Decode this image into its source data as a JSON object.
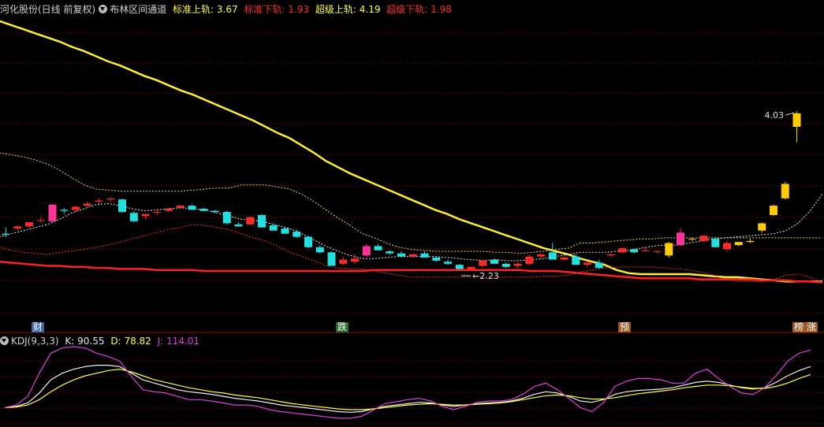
{
  "header": {
    "stock_title": "河化股份(日线 前复权)",
    "indicator_name": "布林区间通道",
    "std_upper": {
      "label": "标准上轨:",
      "value": "3.67"
    },
    "std_lower": {
      "label": "标准下轨:",
      "value": "1.93"
    },
    "super_upper": {
      "label": "超级上轨:",
      "value": "4.19"
    },
    "super_lower": {
      "label": "超级下轨:",
      "value": "1.98"
    }
  },
  "kdj_header": {
    "name": "KDJ(9,3,3)",
    "k": {
      "label": "K:",
      "value": "90.55"
    },
    "d": {
      "label": "D:",
      "value": "78.82"
    },
    "j": {
      "label": "J:",
      "value": "114.01"
    }
  },
  "tags": {
    "cai": "财",
    "die": "跌",
    "yu": "预",
    "bang": "榜",
    "zhang": "涨"
  },
  "annotations": {
    "high_label": "4.03",
    "low_label": "2.23"
  },
  "colors": {
    "up": "#ff2b2b",
    "down": "#23e0e0",
    "yellow": "#ffff33",
    "magenta": "#e040e0",
    "super_upper": "#ffee33",
    "super_lower": "#ff2020",
    "grid": "#7a0000"
  },
  "chart_data": [
    {
      "type": "candlestick",
      "title": "布林区间通道",
      "ylim": [
        1.75,
        4.65
      ],
      "candles": [
        [
          2.55,
          2.61,
          2.52,
          2.54
        ],
        [
          2.6,
          2.63,
          2.58,
          2.62
        ],
        [
          2.62,
          2.66,
          2.6,
          2.66
        ],
        [
          2.68,
          2.71,
          2.66,
          2.68
        ],
        [
          2.67,
          2.84,
          2.66,
          2.83
        ],
        [
          2.78,
          2.8,
          2.74,
          2.77
        ],
        [
          2.78,
          2.82,
          2.76,
          2.81
        ],
        [
          2.82,
          2.86,
          2.81,
          2.84
        ],
        [
          2.86,
          2.89,
          2.84,
          2.87
        ],
        [
          2.88,
          2.9,
          2.86,
          2.89
        ],
        [
          2.88,
          2.89,
          2.75,
          2.76
        ],
        [
          2.75,
          2.77,
          2.66,
          2.67
        ],
        [
          2.72,
          2.74,
          2.69,
          2.74
        ],
        [
          2.76,
          2.78,
          2.73,
          2.76
        ],
        [
          2.77,
          2.8,
          2.76,
          2.79
        ],
        [
          2.8,
          2.83,
          2.79,
          2.82
        ],
        [
          2.82,
          2.83,
          2.78,
          2.78
        ],
        [
          2.79,
          2.8,
          2.76,
          2.77
        ],
        [
          2.77,
          2.78,
          2.75,
          2.76
        ],
        [
          2.76,
          2.77,
          2.64,
          2.65
        ],
        [
          2.64,
          2.66,
          2.62,
          2.62
        ],
        [
          2.64,
          2.72,
          2.63,
          2.71
        ],
        [
          2.73,
          2.74,
          2.61,
          2.61
        ],
        [
          2.63,
          2.64,
          2.58,
          2.58
        ],
        [
          2.6,
          2.61,
          2.55,
          2.55
        ],
        [
          2.57,
          2.59,
          2.51,
          2.52
        ],
        [
          2.52,
          2.53,
          2.41,
          2.42
        ],
        [
          2.42,
          2.44,
          2.36,
          2.37
        ],
        [
          2.37,
          2.38,
          2.24,
          2.24
        ],
        [
          2.26,
          2.33,
          2.25,
          2.3
        ],
        [
          2.28,
          2.35,
          2.26,
          2.31
        ],
        [
          2.34,
          2.45,
          2.33,
          2.43
        ],
        [
          2.43,
          2.45,
          2.39,
          2.39
        ],
        [
          2.38,
          2.39,
          2.35,
          2.36
        ],
        [
          2.36,
          2.38,
          2.32,
          2.33
        ],
        [
          2.33,
          2.36,
          2.32,
          2.35
        ],
        [
          2.36,
          2.38,
          2.32,
          2.32
        ],
        [
          2.32,
          2.33,
          2.28,
          2.29
        ],
        [
          2.28,
          2.3,
          2.25,
          2.26
        ],
        [
          2.25,
          2.26,
          2.21,
          2.21
        ],
        [
          2.21,
          2.23,
          2.19,
          2.23
        ],
        [
          2.24,
          2.3,
          2.23,
          2.29
        ],
        [
          2.3,
          2.31,
          2.26,
          2.26
        ],
        [
          2.26,
          2.27,
          2.22,
          2.23
        ],
        [
          2.24,
          2.27,
          2.22,
          2.26
        ],
        [
          2.26,
          2.35,
          2.25,
          2.33
        ],
        [
          2.33,
          2.36,
          2.31,
          2.35
        ],
        [
          2.37,
          2.46,
          2.3,
          2.3
        ],
        [
          2.3,
          2.33,
          2.29,
          2.32
        ],
        [
          2.33,
          2.35,
          2.25,
          2.25
        ],
        [
          2.25,
          2.28,
          2.23,
          2.27
        ],
        [
          2.27,
          2.3,
          2.21,
          2.22
        ],
        [
          2.34,
          2.36,
          2.33,
          2.35
        ],
        [
          2.37,
          2.42,
          2.36,
          2.41
        ],
        [
          2.4,
          2.41,
          2.36,
          2.37
        ],
        [
          2.39,
          2.42,
          2.38,
          2.39
        ],
        [
          2.38,
          2.39,
          2.36,
          2.38
        ],
        [
          2.34,
          2.47,
          2.32,
          2.46
        ],
        [
          2.44,
          2.6,
          2.43,
          2.56
        ],
        [
          2.5,
          2.51,
          2.48,
          2.5
        ],
        [
          2.48,
          2.54,
          2.47,
          2.53
        ],
        [
          2.5,
          2.51,
          2.42,
          2.42
        ],
        [
          2.4,
          2.48,
          2.38,
          2.46
        ],
        [
          2.44,
          2.47,
          2.43,
          2.47
        ],
        [
          2.47,
          2.5,
          2.46,
          2.48
        ],
        [
          2.58,
          2.66,
          2.56,
          2.65
        ],
        [
          2.73,
          2.83,
          2.72,
          2.82
        ],
        [
          2.89,
          3.05,
          2.88,
          3.03
        ],
        [
          3.58,
          3.73,
          3.43,
          3.71
        ]
      ],
      "super_upper": [
        4.6,
        4.56,
        4.52,
        4.48,
        4.44,
        4.4,
        4.35,
        4.31,
        4.26,
        4.21,
        4.17,
        4.12,
        4.07,
        4.03,
        3.98,
        3.93,
        3.89,
        3.84,
        3.79,
        3.74,
        3.69,
        3.64,
        3.58,
        3.52,
        3.47,
        3.4,
        3.33,
        3.25,
        3.19,
        3.13,
        3.08,
        3.03,
        2.98,
        2.93,
        2.88,
        2.83,
        2.78,
        2.74,
        2.69,
        2.65,
        2.61,
        2.57,
        2.53,
        2.49,
        2.45,
        2.41,
        2.38,
        2.35,
        2.31,
        2.28,
        2.25,
        2.2,
        2.17,
        2.16,
        2.16,
        2.16,
        2.16,
        2.16,
        2.15,
        2.14,
        2.13,
        2.13,
        2.12,
        2.11,
        2.1,
        2.09,
        2.09,
        2.09,
        2.09
      ],
      "std_upper": [
        3.33,
        3.31,
        3.29,
        3.26,
        3.22,
        3.16,
        3.09,
        3.02,
        2.98,
        2.97,
        2.96,
        2.96,
        2.96,
        2.96,
        2.96,
        2.96,
        2.97,
        2.98,
        2.99,
        2.99,
        3.02,
        3.02,
        3.02,
        3.0,
        2.98,
        2.93,
        2.86,
        2.78,
        2.7,
        2.63,
        2.55,
        2.51,
        2.46,
        2.42,
        2.4,
        2.39,
        2.38,
        2.38,
        2.38,
        2.38,
        2.38,
        2.37,
        2.37,
        2.36,
        2.37,
        2.38,
        2.4,
        2.41,
        2.46,
        2.46,
        2.47,
        2.48,
        2.49,
        2.5,
        2.5,
        2.51,
        2.51,
        2.51,
        2.51,
        2.51,
        2.51,
        2.51,
        2.51,
        2.51,
        2.51,
        2.51,
        2.51,
        2.51,
        2.51
      ],
      "mid_line": [
        2.52,
        2.55,
        2.58,
        2.61,
        2.64,
        2.69,
        2.75,
        2.79,
        2.83,
        2.84,
        2.82,
        2.79,
        2.77,
        2.78,
        2.79,
        2.8,
        2.79,
        2.78,
        2.75,
        2.72,
        2.69,
        2.68,
        2.66,
        2.63,
        2.6,
        2.55,
        2.49,
        2.43,
        2.38,
        2.34,
        2.31,
        2.31,
        2.32,
        2.33,
        2.33,
        2.33,
        2.33,
        2.32,
        2.31,
        2.3,
        2.29,
        2.3,
        2.29,
        2.29,
        2.3,
        2.31,
        2.33,
        2.35,
        2.37,
        2.37,
        2.37,
        2.38,
        2.39,
        2.41,
        2.43,
        2.44,
        2.44,
        2.46,
        2.48,
        2.5,
        2.51,
        2.52,
        2.53,
        2.54,
        2.55,
        2.58,
        2.65,
        2.77,
        2.93
      ],
      "std_lower": [
        2.42,
        2.39,
        2.37,
        2.36,
        2.35,
        2.37,
        2.38,
        2.4,
        2.42,
        2.44,
        2.47,
        2.5,
        2.53,
        2.56,
        2.59,
        2.61,
        2.64,
        2.63,
        2.61,
        2.59,
        2.55,
        2.51,
        2.48,
        2.43,
        2.37,
        2.33,
        2.29,
        2.24,
        2.22,
        2.21,
        2.21,
        2.19,
        2.17,
        2.15,
        2.13,
        2.13,
        2.13,
        2.13,
        2.13,
        2.13,
        2.13,
        2.13,
        2.13,
        2.13,
        2.13,
        2.14,
        2.14,
        2.15,
        2.18,
        2.2,
        2.22,
        2.23,
        2.23,
        2.23,
        2.23,
        2.22,
        2.21,
        2.2,
        2.18,
        2.15,
        2.11,
        2.09,
        2.09,
        2.09,
        2.11,
        2.15,
        2.16,
        2.13,
        2.08
      ],
      "super_lower": [
        2.28,
        2.27,
        2.26,
        2.25,
        2.24,
        2.24,
        2.23,
        2.23,
        2.22,
        2.22,
        2.21,
        2.21,
        2.21,
        2.2,
        2.2,
        2.2,
        2.2,
        2.19,
        2.19,
        2.19,
        2.19,
        2.19,
        2.19,
        2.19,
        2.19,
        2.19,
        2.19,
        2.19,
        2.19,
        2.19,
        2.19,
        2.2,
        2.2,
        2.2,
        2.2,
        2.2,
        2.2,
        2.2,
        2.2,
        2.2,
        2.2,
        2.2,
        2.2,
        2.2,
        2.19,
        2.19,
        2.19,
        2.18,
        2.17,
        2.16,
        2.15,
        2.14,
        2.13,
        2.12,
        2.12,
        2.12,
        2.12,
        2.12,
        2.11,
        2.11,
        2.11,
        2.11,
        2.11,
        2.1,
        2.1,
        2.1,
        2.09,
        2.09,
        2.08
      ]
    },
    {
      "type": "line",
      "title": "KDJ(9,3,3)",
      "ylim": [
        -10,
        110
      ],
      "series": [
        {
          "name": "K",
          "values": [
            18,
            20,
            25,
            40,
            60,
            70,
            76,
            80,
            82,
            82,
            80,
            70,
            60,
            55,
            50,
            45,
            42,
            40,
            38,
            35,
            32,
            30,
            28,
            25,
            22,
            20,
            18,
            16,
            14,
            12,
            11,
            12,
            16,
            20,
            22,
            24,
            26,
            25,
            22,
            20,
            22,
            24,
            25,
            26,
            28,
            32,
            38,
            42,
            40,
            35,
            28,
            26,
            30,
            38,
            42,
            44,
            45,
            46,
            48,
            52,
            56,
            58,
            56,
            52,
            48,
            46,
            48,
            56,
            66,
            74,
            80
          ]
        },
        {
          "name": "D",
          "values": [
            18,
            19,
            22,
            30,
            42,
            52,
            60,
            66,
            70,
            74,
            76,
            72,
            66,
            60,
            56,
            52,
            48,
            45,
            42,
            40,
            37,
            35,
            33,
            30,
            27,
            24,
            22,
            20,
            18,
            16,
            15,
            15,
            16,
            18,
            20,
            22,
            23,
            24,
            23,
            22,
            22,
            23,
            24,
            25,
            27,
            30,
            33,
            36,
            37,
            36,
            33,
            31,
            31,
            33,
            36,
            39,
            41,
            43,
            45,
            48,
            50,
            52,
            52,
            51,
            49,
            47,
            47,
            50,
            55,
            62,
            68
          ]
        },
        {
          "name": "J",
          "values": [
            18,
            22,
            35,
            70,
            100,
            108,
            110,
            108,
            100,
            95,
            88,
            65,
            45,
            42,
            40,
            35,
            30,
            30,
            28,
            25,
            22,
            22,
            20,
            15,
            12,
            10,
            8,
            6,
            4,
            2,
            2,
            5,
            14,
            24,
            27,
            30,
            32,
            28,
            20,
            15,
            20,
            26,
            28,
            28,
            30,
            38,
            50,
            55,
            45,
            32,
            18,
            12,
            25,
            50,
            58,
            62,
            62,
            60,
            55,
            55,
            70,
            76,
            62,
            50,
            40,
            38,
            48,
            66,
            88,
            100,
            105
          ]
        }
      ]
    }
  ]
}
